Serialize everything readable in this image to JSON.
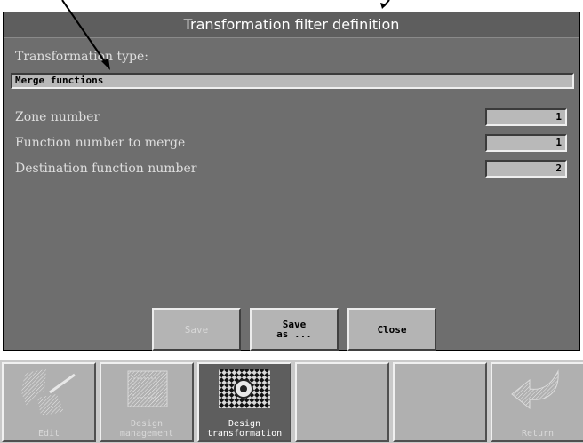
{
  "dialog": {
    "title": "Transformation filter definition",
    "type_label": "Transformation type:",
    "type_value": "Merge functions",
    "fields": [
      {
        "label": "Zone number",
        "value": "1"
      },
      {
        "label": "Function number to merge",
        "value": "1"
      },
      {
        "label": "Destination function number",
        "value": "2"
      }
    ],
    "buttons": {
      "save": "Save",
      "save_as": "Save\nas ...",
      "close": "Close"
    }
  },
  "taskbar": {
    "edit": "Edit",
    "design_management": "Design\nmanagement",
    "design_transformation": "Design\ntransformation",
    "return": "Return",
    "icons": [
      "edit-icon",
      "design-management-icon",
      "design-transformation-icon",
      "return-arrow-icon"
    ]
  },
  "colors": {
    "dialog_bg": "#6e6e6e",
    "titlebar_bg": "#5e5e5e",
    "field_bg": "#b9b9b9",
    "taskbar_bg": "#c9c9c9"
  }
}
